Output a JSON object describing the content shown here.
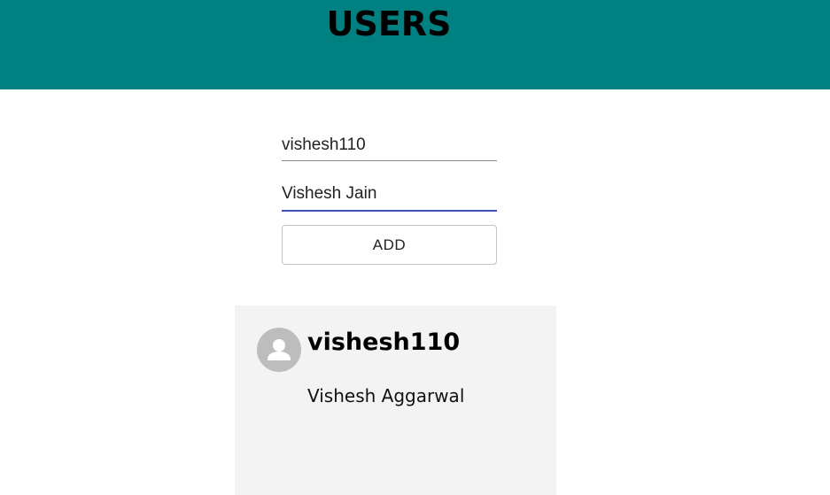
{
  "header": {
    "title": "USERS"
  },
  "form": {
    "username_value": "vishesh110",
    "fullname_value": "Vishesh Jain",
    "add_label": "ADD"
  },
  "users": [
    {
      "username": "vishesh110",
      "fullname": "Vishesh Aggarwal",
      "avatar_icon": "person-icon"
    }
  ],
  "colors": {
    "header_bg": "#008080",
    "focused_underline": "#3f51b5",
    "card_bg": "#f3f3f3",
    "avatar_bg": "#bdbdbd"
  }
}
